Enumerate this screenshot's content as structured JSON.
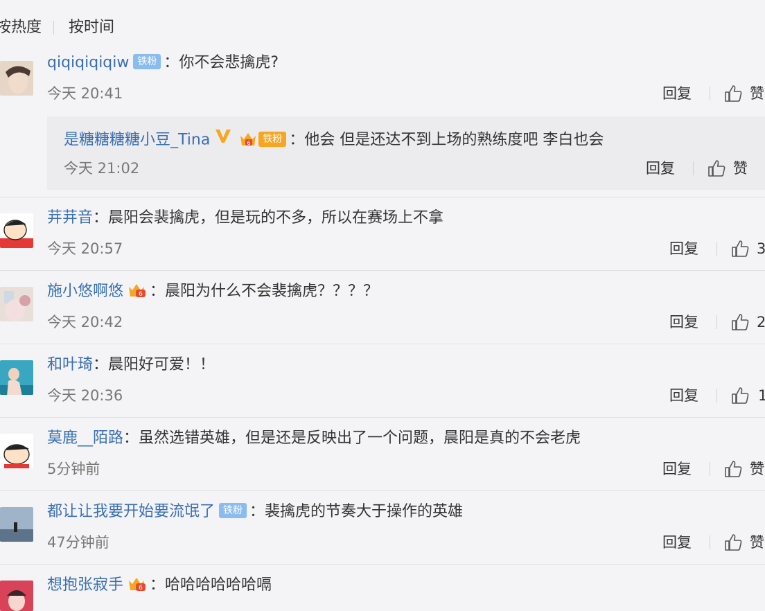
{
  "sort": {
    "hot": "按热度",
    "time": "按时间"
  },
  "comments": [
    {
      "user": "qiqiqiqiqiw",
      "badge": "铁粉",
      "text": "你不会悲擒虎?",
      "time": "今天 20:41",
      "reply": "回复",
      "like": "赞"
    },
    {
      "user": "是糖糖糖糖小豆_Tina",
      "badge": "铁粉",
      "text": "他会  但是还达不到上场的熟练度吧   李白也会",
      "time": "今天 21:02",
      "reply": "回复",
      "like": "赞"
    },
    {
      "user": "茾茾音",
      "text": "晨阳会裴擒虎，但是玩的不多，所以在赛场上不拿",
      "time": "今天 20:57",
      "reply": "回复",
      "like": "3"
    },
    {
      "user": "施小悠啊悠",
      "text": "晨阳为什么不会裴擒虎？？？？",
      "time": "今天 20:42",
      "reply": "回复",
      "like": "2"
    },
    {
      "user": "和叶琦",
      "text": "晨阳好可爱！！",
      "time": "今天 20:36",
      "reply": "回复",
      "like": "1"
    },
    {
      "user": "莫鹿__陌路",
      "text": "虽然选错英雄，但是还是反映出了一个问题，晨阳是真的不会老虎",
      "time": "5分钟前",
      "reply": "回复",
      "like": "赞"
    },
    {
      "user": "都让让我要开始要流氓了",
      "badge": "铁粉",
      "text": "裴擒虎的节奏大于操作的英雄",
      "time": "47分钟前",
      "reply": "回复",
      "like": "赞"
    },
    {
      "user": "想抱张寂手",
      "text": "哈哈哈哈哈哈嗝",
      "time": "",
      "reply": "回复",
      "like": "赞"
    }
  ],
  "colors": {
    "username": "#3a6fb2",
    "badge": "#8bbcf0",
    "crown": "#f6a623",
    "background": "#f4f4f6"
  }
}
